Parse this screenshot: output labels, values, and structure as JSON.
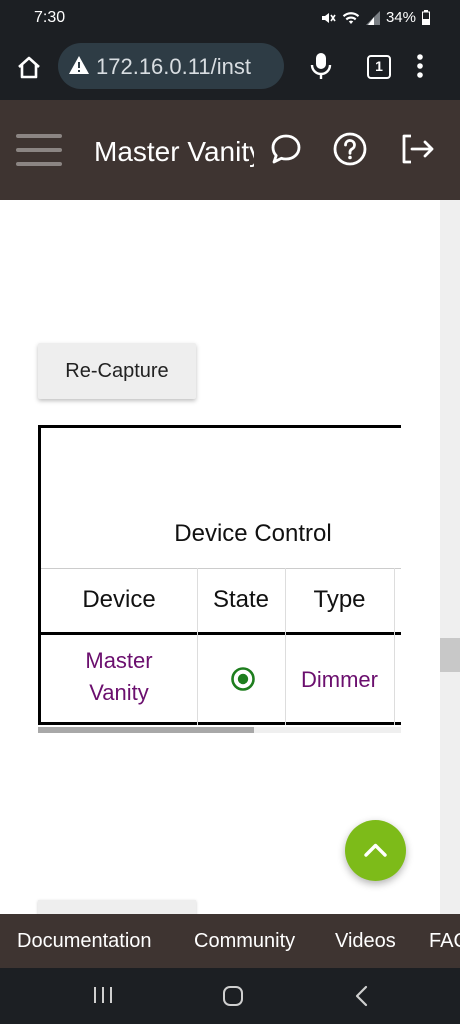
{
  "status_bar": {
    "time": "7:30",
    "battery": "34%"
  },
  "browser": {
    "url": "172.16.0.11/inst",
    "tab_count": "1"
  },
  "header": {
    "title": "Master Vanity"
  },
  "main": {
    "recapture_label": "Re-Capture",
    "table": {
      "caption": "Device Control",
      "columns": [
        "Device",
        "State",
        "Type"
      ],
      "rows": [
        {
          "device_line1": "Master",
          "device_line2": "Vanity",
          "state": "on",
          "type": "Dimmer"
        }
      ]
    }
  },
  "footer_nav": {
    "items": [
      "Documentation",
      "Community",
      "Videos",
      "FAQ"
    ]
  },
  "colors": {
    "header_bg": "#3e3431",
    "link": "#6b0f6e",
    "accent_fab": "#7dbb19",
    "state_on": "#1e7e1e"
  }
}
